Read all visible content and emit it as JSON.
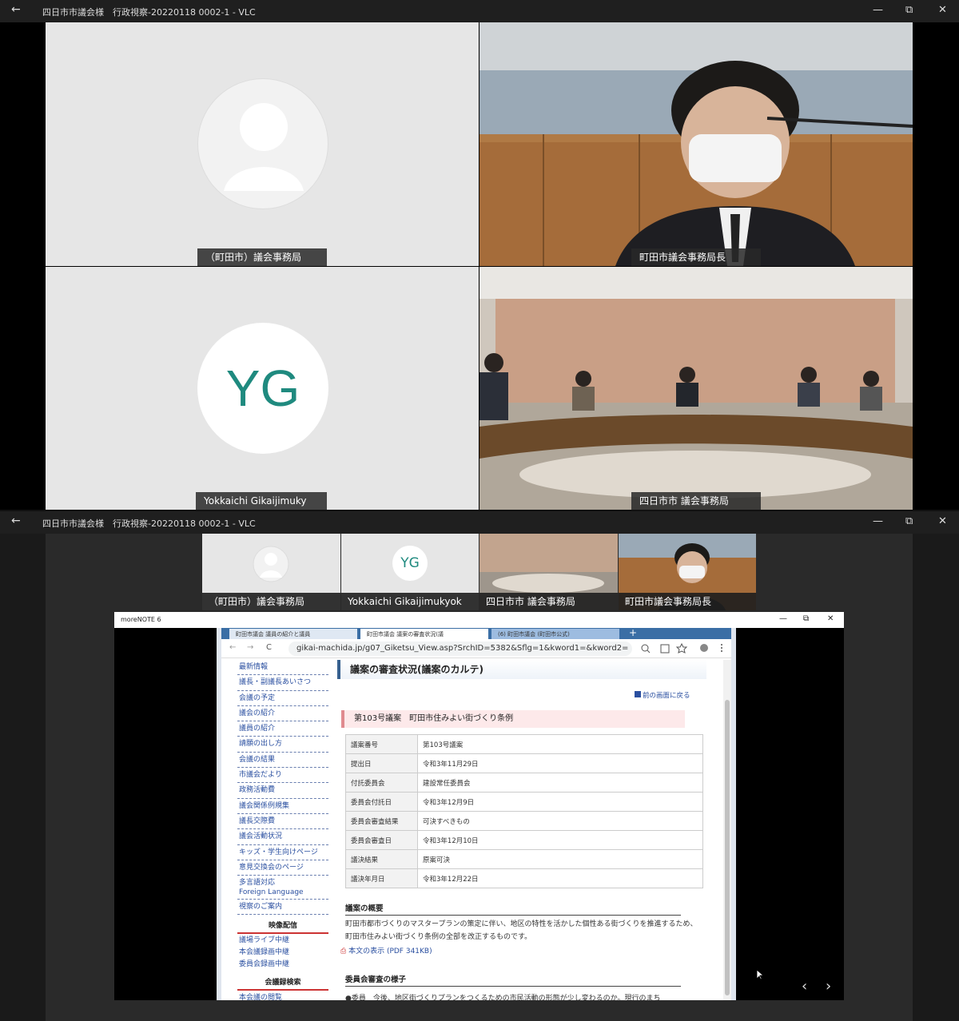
{
  "window_top": {
    "title": "四日市市議会様　行政視察-20220118 0002-1 - VLC",
    "back": "←",
    "min": "—",
    "max": "⧉",
    "close": "✕"
  },
  "window_bottom": {
    "title": "四日市市議会様　行政視察-20220118 0002-1 - VLC",
    "back": "←",
    "min": "—",
    "max": "⧉",
    "close": "✕"
  },
  "grid": {
    "tile1_name": "（町田市）議会事務局",
    "tile2_name": "町田市議会事務局長",
    "tile3_name": "Yokkaichi Gikaijimuky",
    "tile3_initials": "YG",
    "tile4_name": "四日市市 議会事務局"
  },
  "thumbs": [
    "（町田市）議会事務局",
    "Yokkaichi Gikaijimukyok",
    "四日市市 議会事務局",
    "町田市議会事務局長"
  ],
  "thumb_initials": "YG",
  "share": {
    "app_title": "moreNOTE 6",
    "min": "—",
    "max": "⧉",
    "close": "✕",
    "tabs": [
      "町田市議会 議員の紹介と議員",
      "町田市議会 議案の審査状況(議",
      "(6) 町田市議会 (町田市公式)"
    ],
    "tab_plus": "+",
    "url": "gikai-machida.jp/g07_Giketsu_View.asp?SrchID=5382&Sflg=1&kword1=&kword2=",
    "nav": [
      "←",
      "→",
      "C"
    ],
    "side_items": [
      "最新情報",
      "議長・副議長あいさつ",
      "会議の予定",
      "議会の紹介",
      "議員の紹介",
      "請願の出し方",
      "会議の結果",
      "市議会だより",
      "政務活動費",
      "議会関係例規集",
      "議長交際費",
      "議会活動状況",
      "キッズ・学生向けページ",
      "意見交換会のページ"
    ],
    "side_multi": [
      "多言語対応",
      "Foreign Language"
    ],
    "side_item_last": "視察のご案内",
    "side_hd1": "映像配信",
    "side_video": [
      "議場ライブ中継",
      "本会議録画中継",
      "委員会録画中継"
    ],
    "side_hd2": "会議録検索",
    "side_tail": "本会議の閲覧",
    "page_title": "議案の審査状況(議案のカルテ)",
    "back_link": "前の画面に戻る",
    "bill_title": "第103号議案　町田市住みよい街づくり条例",
    "rows": [
      [
        "議案番号",
        "第103号議案"
      ],
      [
        "提出日",
        "令和3年11月29日"
      ],
      [
        "付託委員会",
        "建設常任委員会"
      ],
      [
        "委員会付託日",
        "令和3年12月9日"
      ],
      [
        "委員会審査結果",
        "可決すべきもの"
      ],
      [
        "委員会審査日",
        "令和3年12月10日"
      ],
      [
        "議決結果",
        "原案可決"
      ],
      [
        "議決年月日",
        "令和3年12月22日"
      ]
    ],
    "summary_head": "議案の概要",
    "summary_text": "町田市都市づくりのマスタープランの策定に伴い、地区の特性を活かした個性ある街づくりを推進するため、町田市住みよい街づくり条例の全部を改正するものです。",
    "pdf_link": "本文の表示 (PDF 341KB)",
    "committee_head": "委員会審査の様子",
    "committee_text": "●委員　今後、地区街づくりプランをつくるための市民活動の形態が少し変わるのか。現行のまち",
    "prev": "‹",
    "next": "›"
  }
}
